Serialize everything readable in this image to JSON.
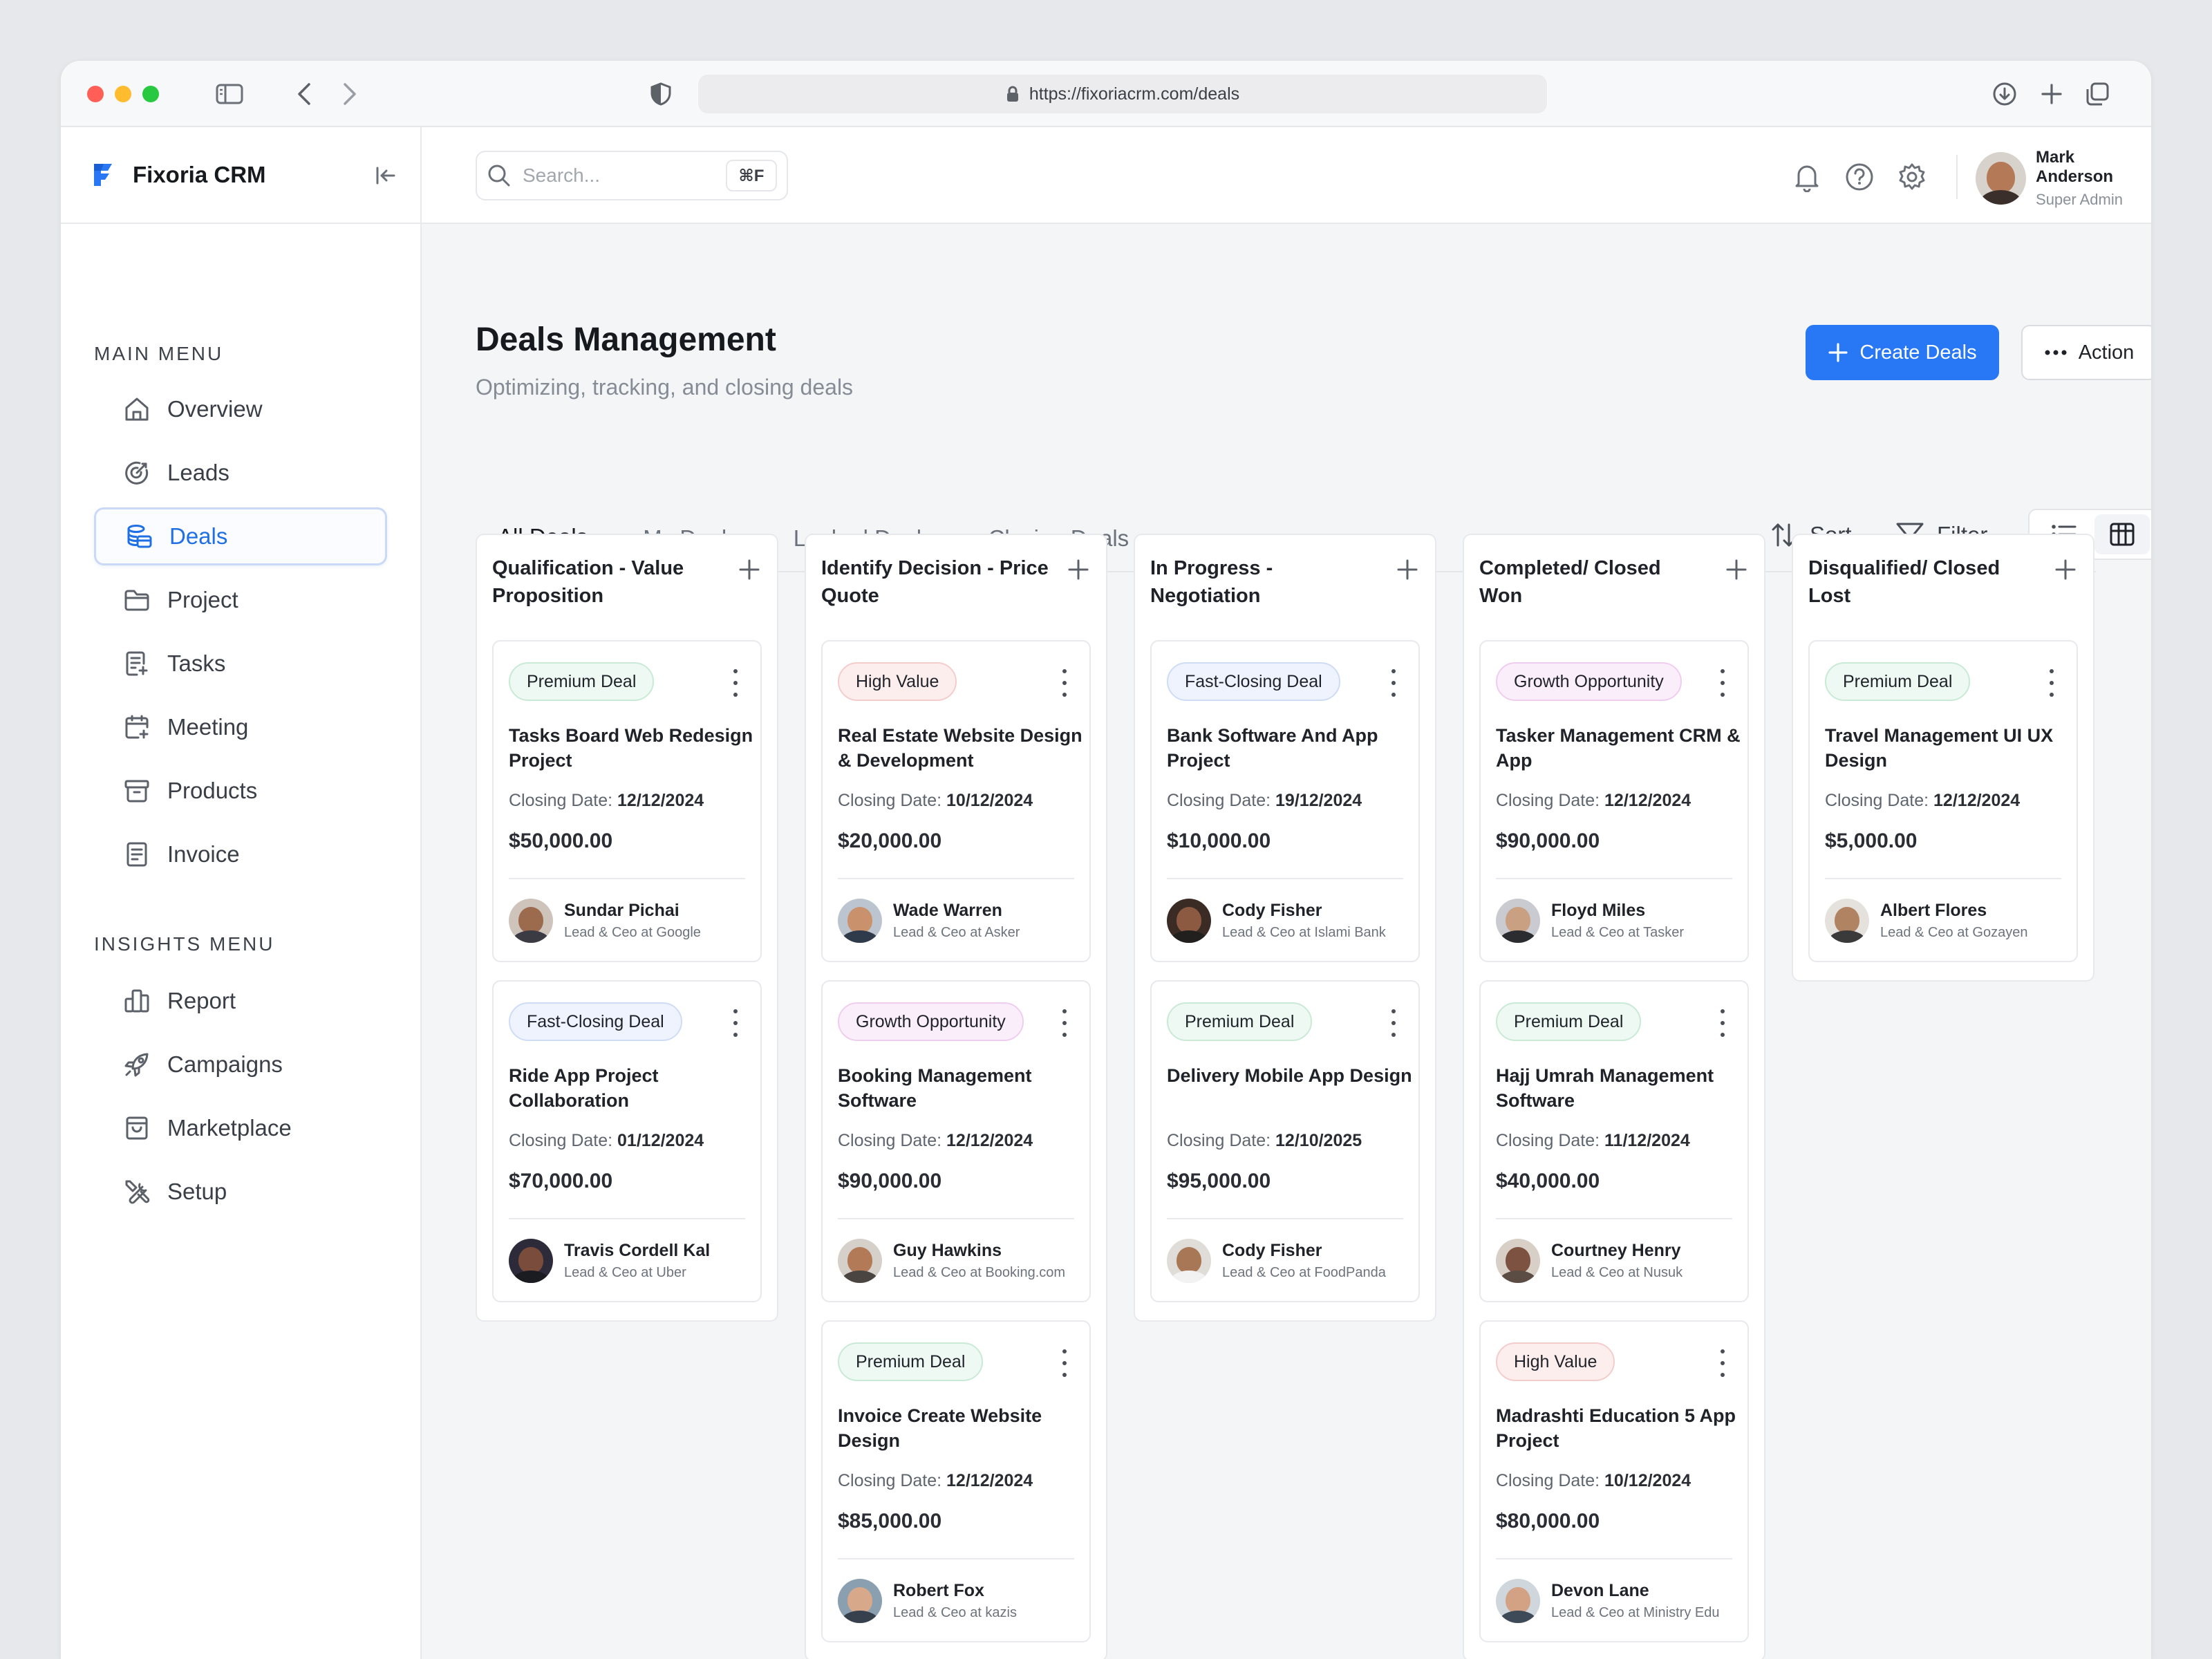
{
  "browser": {
    "url": "https://fixoriacrm.com/deals"
  },
  "sidebar": {
    "brand": "Fixoria CRM",
    "main_menu_title": "MAIN MENU",
    "insights_menu_title": "INSIGHTS MENU",
    "main_items": [
      {
        "label": "Overview",
        "icon": "home-icon"
      },
      {
        "label": "Leads",
        "icon": "target-icon"
      },
      {
        "label": "Deals",
        "icon": "coins-icon"
      },
      {
        "label": "Project",
        "icon": "folder-icon"
      },
      {
        "label": "Tasks",
        "icon": "task-list-icon"
      },
      {
        "label": "Meeting",
        "icon": "calendar-icon"
      },
      {
        "label": "Products",
        "icon": "box-icon"
      },
      {
        "label": "Invoice",
        "icon": "document-icon"
      }
    ],
    "insight_items": [
      {
        "label": "Report",
        "icon": "bar-chart-icon"
      },
      {
        "label": "Campaigns",
        "icon": "rocket-icon"
      },
      {
        "label": "Marketplace",
        "icon": "shopping-bag-icon"
      },
      {
        "label": "Setup",
        "icon": "tools-icon"
      }
    ],
    "active_item": "Deals"
  },
  "topbar": {
    "search_placeholder": "Search...",
    "search_shortcut": "⌘F",
    "user_name": "Mark Anderson",
    "user_role": "Super Admin"
  },
  "page": {
    "title": "Deals Management",
    "subtitle": "Optimizing, tracking, and closing deals",
    "create_label": "Create Deals",
    "action_label": "Action",
    "tabs": [
      "All Deals",
      "My Deals",
      "Looked Deals",
      "Closing Deals"
    ],
    "active_tab": "All Deals",
    "sort_label": "Sort",
    "filter_label": "Filter"
  },
  "colors": {
    "accent": "#2877f5",
    "premium": "#eef9f3",
    "high_value": "#fdeeee",
    "fast_closing": "#eef3fd",
    "growth": "#fbeefb"
  },
  "board": {
    "closing_label": "Closing Date:",
    "columns": [
      {
        "title": "Qualification - Value Proposition",
        "cards": [
          {
            "badge": "Premium Deal",
            "badge_type": "premium",
            "title": "Tasks Board Web Redesign Project",
            "date": "12/12/2024",
            "amount": "$50,000.00",
            "person": "Sundar Pichai",
            "role": "Lead & Ceo at Google"
          },
          {
            "badge": "Fast-Closing Deal",
            "badge_type": "fast",
            "title": "Ride App Project Collaboration",
            "date": "01/12/2024",
            "amount": "$70,000.00",
            "person": "Travis Cordell Kal",
            "role": "Lead & Ceo at Uber"
          }
        ]
      },
      {
        "title": "Identify Decision - Price Quote",
        "cards": [
          {
            "badge": "High Value",
            "badge_type": "high",
            "title": "Real Estate Website Design & Development",
            "date": "10/12/2024",
            "amount": "$20,000.00",
            "person": "Wade Warren",
            "role": "Lead & Ceo at Asker"
          },
          {
            "badge": "Growth Opportunity",
            "badge_type": "growth",
            "title": "Booking Management Software",
            "date": "12/12/2024",
            "amount": "$90,000.00",
            "person": "Guy Hawkins",
            "role": "Lead & Ceo at Booking.com"
          },
          {
            "badge": "Premium Deal",
            "badge_type": "premium",
            "title": "Invoice Create Website Design",
            "date": "12/12/2024",
            "amount": "$85,000.00",
            "person": "Robert Fox",
            "role": "Lead & Ceo at kazis"
          }
        ]
      },
      {
        "title": "In Progress - Negotiation",
        "cards": [
          {
            "badge": "Fast-Closing Deal",
            "badge_type": "fast",
            "title": "Bank Software And App Project",
            "date": "19/12/2024",
            "amount": "$10,000.00",
            "person": "Cody Fisher",
            "role": "Lead & Ceo at Islami Bank"
          },
          {
            "badge": "Premium Deal",
            "badge_type": "premium",
            "title": "Delivery Mobile App Design",
            "date": "12/10/2025",
            "amount": "$95,000.00",
            "person": "Cody Fisher",
            "role": "Lead & Ceo at FoodPanda"
          }
        ]
      },
      {
        "title": "Completed/ Closed Won",
        "cards": [
          {
            "badge": "Growth Opportunity",
            "badge_type": "growth",
            "title": "Tasker Management CRM & App",
            "date": "12/12/2024",
            "amount": "$90,000.00",
            "person": "Floyd Miles",
            "role": "Lead & Ceo at Tasker"
          },
          {
            "badge": "Premium Deal",
            "badge_type": "premium",
            "title": "Hajj Umrah Management Software",
            "date": "11/12/2024",
            "amount": "$40,000.00",
            "person": "Courtney Henry",
            "role": "Lead & Ceo at Nusuk"
          },
          {
            "badge": "High Value",
            "badge_type": "high",
            "title": "Madrashti Education 5 App Project",
            "date": "10/12/2024",
            "amount": "$80,000.00",
            "person": "Devon Lane",
            "role": "Lead & Ceo at Ministry Edu"
          }
        ]
      },
      {
        "title": "Disqualified/ Closed Lost",
        "cards": [
          {
            "badge": "Premium Deal",
            "badge_type": "premium",
            "title": "Travel Management UI UX Design",
            "date": "12/12/2024",
            "amount": "$5,000.00",
            "person": "Albert Flores",
            "role": "Lead & Ceo at Gozayen"
          }
        ]
      }
    ]
  }
}
